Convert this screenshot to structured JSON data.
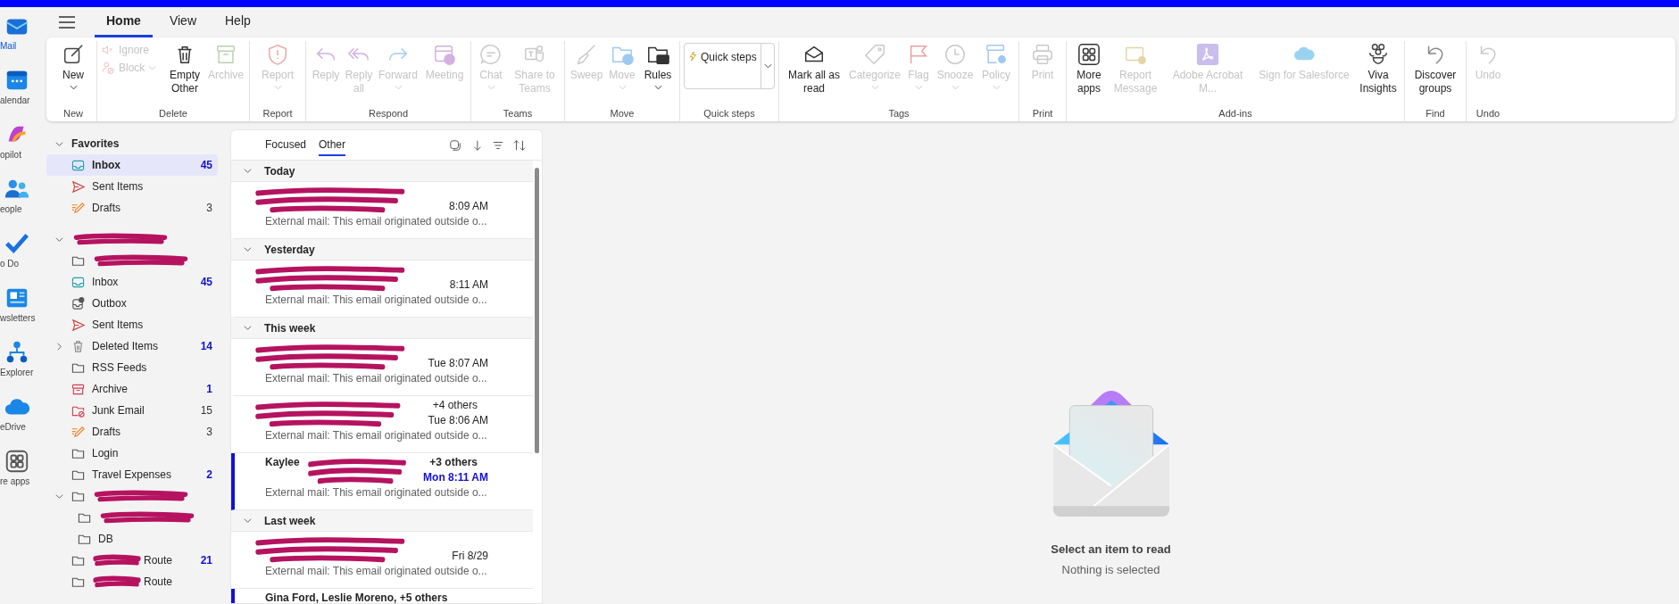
{
  "rail": [
    {
      "label": "Mail",
      "selected": true
    },
    {
      "label": "alendar",
      "selected": false
    },
    {
      "label": "opilot",
      "selected": false
    },
    {
      "label": "eople",
      "selected": false
    },
    {
      "label": "o Do",
      "selected": false
    },
    {
      "label": "wsletters",
      "selected": false
    },
    {
      "label": "Explorer",
      "selected": false
    },
    {
      "label": "eDrive",
      "selected": false
    },
    {
      "label": "re apps",
      "selected": false
    }
  ],
  "tabs": [
    {
      "label": "Home",
      "selected": true
    },
    {
      "label": "View",
      "selected": false
    },
    {
      "label": "Help",
      "selected": false
    }
  ],
  "ribbon_groups": [
    {
      "label": "New",
      "buttons": [
        {
          "kind": "large",
          "label": "New",
          "disabled": false,
          "dropdown": true
        }
      ]
    },
    {
      "label": "Delete",
      "buttons": [
        {
          "kind": "small",
          "label": "Ignore",
          "disabled": true,
          "dropdown": false
        },
        {
          "kind": "small",
          "label": "Block",
          "disabled": true,
          "dropdown": true
        },
        {
          "kind": "large",
          "label": "Empty Other",
          "disabled": false,
          "dropdown": false
        },
        {
          "kind": "large",
          "label": "Archive",
          "disabled": true,
          "dropdown": false
        }
      ]
    },
    {
      "label": "Report",
      "buttons": [
        {
          "kind": "large",
          "label": "Report",
          "disabled": true,
          "dropdown": true
        }
      ]
    },
    {
      "label": "Respond",
      "buttons": [
        {
          "kind": "large",
          "label": "Reply",
          "disabled": true,
          "dropdown": false
        },
        {
          "kind": "large",
          "label": "Reply all",
          "disabled": true,
          "dropdown": false
        },
        {
          "kind": "large",
          "label": "Forward",
          "disabled": true,
          "dropdown": true
        },
        {
          "kind": "large",
          "label": "Meeting",
          "disabled": true,
          "dropdown": false
        }
      ]
    },
    {
      "label": "Teams",
      "buttons": [
        {
          "kind": "large",
          "label": "Chat",
          "disabled": true,
          "dropdown": true
        },
        {
          "kind": "large",
          "label": "Share to Teams",
          "disabled": true,
          "dropdown": false
        }
      ]
    },
    {
      "label": "Move",
      "buttons": [
        {
          "kind": "large",
          "label": "Sweep",
          "disabled": true,
          "dropdown": false
        },
        {
          "kind": "large",
          "label": "Move",
          "disabled": true,
          "dropdown": true
        },
        {
          "kind": "large",
          "label": "Rules",
          "disabled": false,
          "dropdown": true
        }
      ]
    },
    {
      "label": "Quick steps",
      "buttons": [
        {
          "kind": "gallery",
          "label": "Quick steps",
          "disabled": false,
          "dropdown": true
        }
      ]
    },
    {
      "label": "Tags",
      "buttons": [
        {
          "kind": "large",
          "label": "Mark all as read",
          "disabled": false,
          "dropdown": false
        },
        {
          "kind": "large",
          "label": "Categorize",
          "disabled": true,
          "dropdown": true
        },
        {
          "kind": "large",
          "label": "Flag",
          "disabled": true,
          "dropdown": true
        },
        {
          "kind": "large",
          "label": "Snooze",
          "disabled": true,
          "dropdown": true
        },
        {
          "kind": "large",
          "label": "Policy",
          "disabled": true,
          "dropdown": true
        }
      ]
    },
    {
      "label": "Print",
      "buttons": [
        {
          "kind": "large",
          "label": "Print",
          "disabled": true,
          "dropdown": false
        }
      ]
    },
    {
      "label": "Add-ins",
      "buttons": [
        {
          "kind": "large",
          "label": "More apps",
          "disabled": false,
          "dropdown": false
        },
        {
          "kind": "large",
          "label": "Report Message",
          "disabled": true,
          "dropdown": false
        },
        {
          "kind": "large",
          "label": "Adobe Acrobat M...",
          "disabled": true,
          "dropdown": false
        },
        {
          "kind": "large",
          "label": "Sign for Salesforce",
          "disabled": true,
          "dropdown": false
        },
        {
          "kind": "large",
          "label": "Viva Insights",
          "disabled": false,
          "dropdown": false
        }
      ]
    },
    {
      "label": "Find",
      "buttons": [
        {
          "kind": "large",
          "label": "Discover groups",
          "disabled": false,
          "dropdown": false
        }
      ]
    },
    {
      "label": "Undo",
      "buttons": [
        {
          "kind": "large",
          "label": "Undo",
          "disabled": true,
          "dropdown": false
        }
      ]
    }
  ],
  "folder_tree": [
    {
      "kind": "section",
      "name": "Favorites",
      "expanded": true,
      "children": [
        {
          "kind": "inbox",
          "name": "Inbox",
          "count": "45",
          "unread": true,
          "selected": true
        },
        {
          "kind": "sent",
          "name": "Sent Items",
          "selected": false
        },
        {
          "kind": "drafts",
          "name": "Drafts",
          "count": "3",
          "unread": false,
          "selected": false
        }
      ]
    },
    {
      "kind": "section",
      "redacted": true,
      "expanded": true,
      "children": [
        {
          "kind": "folder",
          "redacted": true,
          "selected": false
        },
        {
          "kind": "inbox",
          "name": "Inbox",
          "count": "45",
          "unread": true,
          "selected": false
        },
        {
          "kind": "outbox",
          "name": "Outbox",
          "selected": false
        },
        {
          "kind": "sent",
          "name": "Sent Items",
          "selected": false
        },
        {
          "kind": "deleted",
          "name": "Deleted Items",
          "count": "14",
          "unread": true,
          "expanded": false,
          "selected": false
        },
        {
          "kind": "folder",
          "name": "RSS Feeds",
          "selected": false
        },
        {
          "kind": "archive",
          "name": "Archive",
          "count": "1",
          "unread": true,
          "selected": false
        },
        {
          "kind": "junk",
          "name": "Junk Email",
          "count": "15",
          "unread": false,
          "selected": false
        },
        {
          "kind": "drafts",
          "name": "Drafts",
          "count": "3",
          "unread": false,
          "selected": false
        },
        {
          "kind": "folder",
          "name": "Login",
          "selected": false
        },
        {
          "kind": "folder",
          "name": "Travel Expenses",
          "count": "2",
          "unread": true,
          "selected": false
        },
        {
          "kind": "folder",
          "redacted": true,
          "expanded": true,
          "selected": false,
          "children": [
            {
              "kind": "folder",
              "redacted": true,
              "selected": false
            },
            {
              "kind": "folder",
              "name": "DB",
              "selected": false
            }
          ]
        },
        {
          "kind": "folder",
          "name": "Route",
          "redacted": true,
          "count": "21",
          "unread": true,
          "selected": false
        },
        {
          "kind": "folder",
          "name": "Route",
          "redacted": true,
          "selected": false
        }
      ]
    }
  ],
  "message_list": {
    "tabs": [
      {
        "label": "Focused",
        "selected": false
      },
      {
        "label": "Other",
        "selected": true
      }
    ],
    "groups": [
      {
        "label": "Today",
        "expanded": true,
        "messages": [
          {
            "redacted": true,
            "time": "8:09 AM",
            "preview": "External mail: This email originated outside o...",
            "unread": false
          }
        ]
      },
      {
        "label": "Yesterday",
        "expanded": true,
        "messages": [
          {
            "redacted": true,
            "time": "8:11 AM",
            "preview": "External mail: This email originated outside o...",
            "unread": false
          }
        ]
      },
      {
        "label": "This week",
        "expanded": true,
        "messages": [
          {
            "redacted": true,
            "time": "Tue 8:07 AM",
            "preview": "External mail: This email originated outside o...",
            "unread": false
          },
          {
            "redacted": true,
            "sender_end": "+4 others",
            "time": "Tue 8:06 AM",
            "preview": "External mail: This email originated outside o...",
            "unread": false
          },
          {
            "redacted": true,
            "sender": "Kaylee",
            "sender_end": "+3 others",
            "time": "Mon 8:11 AM",
            "preview": "External mail: This email originated outside o...",
            "unread": true
          }
        ]
      },
      {
        "label": "Last week",
        "expanded": true,
        "messages": [
          {
            "redacted": true,
            "time": "Fri 8/29",
            "preview": "External mail: This email originated outside o...",
            "unread": false
          },
          {
            "sender": "Gina Ford, Leslie Moreno, +5 others",
            "unread": true
          }
        ]
      }
    ]
  },
  "reading_pane": {
    "title": "Select an item to read",
    "subtitle": "Nothing is selected"
  }
}
